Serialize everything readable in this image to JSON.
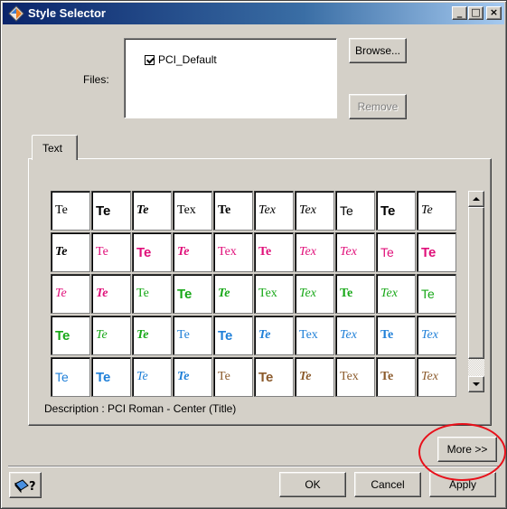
{
  "window": {
    "title": "Style Selector"
  },
  "titlebar": {
    "minimize_glyph": "_",
    "maximize_glyph": "□",
    "close_glyph": "×"
  },
  "files": {
    "label": "Files:",
    "items": [
      {
        "name": "PCI_Default",
        "checked": true
      }
    ],
    "browse_label": "Browse...",
    "remove_label": "Remove"
  },
  "tabs": [
    {
      "label": "Text",
      "active": true
    }
  ],
  "style_grid": {
    "rows": [
      [
        {
          "text": "Te",
          "color": "#000000",
          "style": "serif"
        },
        {
          "text": "Te",
          "color": "#000000",
          "style": "sans-bold"
        },
        {
          "text": "Te",
          "color": "#000000",
          "style": "serif-bold-italic"
        },
        {
          "text": "Tex",
          "color": "#000000",
          "style": "serif"
        },
        {
          "text": "Te",
          "color": "#000000",
          "style": "serif-bold"
        },
        {
          "text": "Tex",
          "color": "#000000",
          "style": "serif-italic"
        },
        {
          "text": "Tex",
          "color": "#000000",
          "style": "serif-italic"
        },
        {
          "text": "Te",
          "color": "#000000",
          "style": "sans"
        },
        {
          "text": "Te",
          "color": "#000000",
          "style": "sans-bold"
        },
        {
          "text": "Te",
          "color": "#000000",
          "style": "serif-italic"
        }
      ],
      [
        {
          "text": "Te",
          "color": "#000000",
          "style": "serif-bold-italic"
        },
        {
          "text": "Te",
          "color": "#e0107a",
          "style": "serif"
        },
        {
          "text": "Te",
          "color": "#e0107a",
          "style": "sans-bold"
        },
        {
          "text": "Te",
          "color": "#e0107a",
          "style": "serif-bold-italic"
        },
        {
          "text": "Tex",
          "color": "#e0107a",
          "style": "serif"
        },
        {
          "text": "Te",
          "color": "#e0107a",
          "style": "serif-bold"
        },
        {
          "text": "Tex",
          "color": "#e0107a",
          "style": "serif-italic"
        },
        {
          "text": "Tex",
          "color": "#e0107a",
          "style": "serif-italic"
        },
        {
          "text": "Te",
          "color": "#e0107a",
          "style": "sans"
        },
        {
          "text": "Te",
          "color": "#e0107a",
          "style": "sans-bold"
        }
      ],
      [
        {
          "text": "Te",
          "color": "#e0107a",
          "style": "serif-italic"
        },
        {
          "text": "Te",
          "color": "#e0107a",
          "style": "serif-bold-italic"
        },
        {
          "text": "Te",
          "color": "#18a818",
          "style": "serif"
        },
        {
          "text": "Te",
          "color": "#18a818",
          "style": "sans-bold"
        },
        {
          "text": "Te",
          "color": "#18a818",
          "style": "serif-bold-italic"
        },
        {
          "text": "Tex",
          "color": "#18a818",
          "style": "serif"
        },
        {
          "text": "Tex",
          "color": "#18a818",
          "style": "serif-italic"
        },
        {
          "text": "Te",
          "color": "#18a818",
          "style": "serif-bold"
        },
        {
          "text": "Tex",
          "color": "#18a818",
          "style": "serif-italic"
        },
        {
          "text": "Te",
          "color": "#18a818",
          "style": "sans"
        }
      ],
      [
        {
          "text": "Te",
          "color": "#18a818",
          "style": "sans-bold"
        },
        {
          "text": "Te",
          "color": "#18a818",
          "style": "serif-italic"
        },
        {
          "text": "Te",
          "color": "#18a818",
          "style": "serif-bold-italic"
        },
        {
          "text": "Te",
          "color": "#2080d8",
          "style": "serif"
        },
        {
          "text": "Te",
          "color": "#2080d8",
          "style": "sans-bold"
        },
        {
          "text": "Te",
          "color": "#2080d8",
          "style": "serif-bold-italic"
        },
        {
          "text": "Tex",
          "color": "#2080d8",
          "style": "serif"
        },
        {
          "text": "Tex",
          "color": "#2080d8",
          "style": "serif-italic"
        },
        {
          "text": "Te",
          "color": "#2080d8",
          "style": "serif-bold"
        },
        {
          "text": "Tex",
          "color": "#2080d8",
          "style": "serif-italic"
        }
      ],
      [
        {
          "text": "Te",
          "color": "#2080d8",
          "style": "sans"
        },
        {
          "text": "Te",
          "color": "#2080d8",
          "style": "sans-bold"
        },
        {
          "text": "Te",
          "color": "#2080d8",
          "style": "serif-italic"
        },
        {
          "text": "Te",
          "color": "#2080d8",
          "style": "serif-bold-italic"
        },
        {
          "text": "Te",
          "color": "#8b5a2b",
          "style": "serif"
        },
        {
          "text": "Te",
          "color": "#8b5a2b",
          "style": "sans-bold"
        },
        {
          "text": "Te",
          "color": "#8b5a2b",
          "style": "serif-bold-italic"
        },
        {
          "text": "Tex",
          "color": "#8b5a2b",
          "style": "serif"
        },
        {
          "text": "Te",
          "color": "#8b5a2b",
          "style": "serif-bold"
        },
        {
          "text": "Tex",
          "color": "#8b5a2b",
          "style": "serif-italic"
        }
      ]
    ]
  },
  "description": {
    "text": "Description : PCI Roman - Center (Title)"
  },
  "more_button": {
    "label": "More >>"
  },
  "footer": {
    "ok_label": "OK",
    "cancel_label": "Cancel",
    "apply_label": "Apply"
  },
  "icons": {
    "help": "help-pointer-icon",
    "app": "app-logo-icon"
  },
  "colors": {
    "window_bg": "#d4d0c8",
    "titlebar": "#0a246a",
    "highlight": "#e8101a"
  }
}
